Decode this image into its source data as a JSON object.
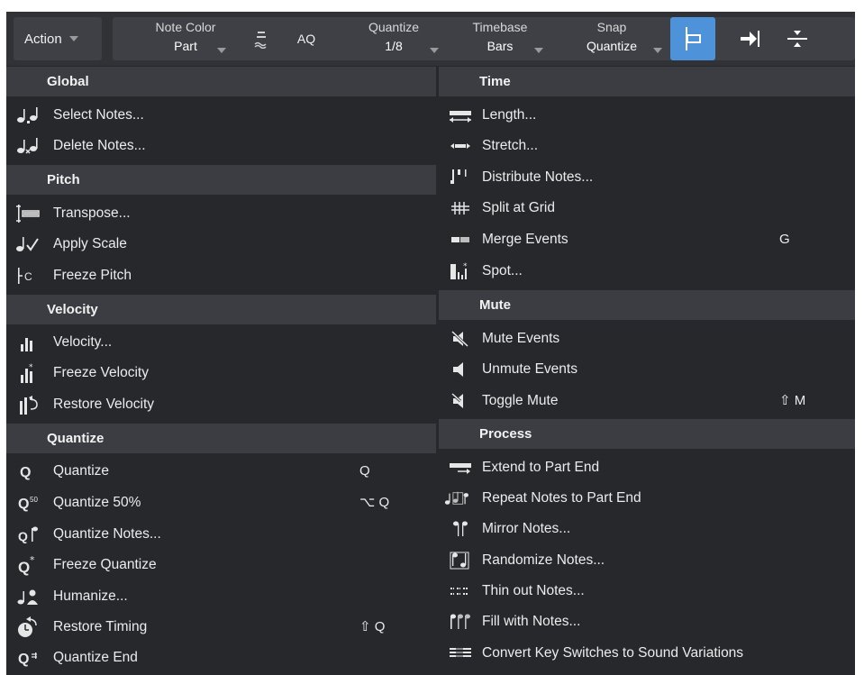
{
  "toolbar": {
    "action_label": "Action",
    "note_color": {
      "label": "Note Color",
      "value": "Part"
    },
    "aq_label": "AQ",
    "quantize": {
      "label": "Quantize",
      "value": "1/8"
    },
    "timebase": {
      "label": "Timebase",
      "value": "Bars"
    },
    "snap": {
      "label": "Snap",
      "value": "Quantize"
    }
  },
  "left": {
    "global": {
      "header": "Global",
      "items": [
        {
          "label": "Select Notes...",
          "icon": "select-notes-icon"
        },
        {
          "label": "Delete Notes...",
          "icon": "delete-notes-icon"
        }
      ]
    },
    "pitch": {
      "header": "Pitch",
      "items": [
        {
          "label": "Transpose...",
          "icon": "transpose-icon"
        },
        {
          "label": "Apply Scale",
          "icon": "apply-scale-icon"
        },
        {
          "label": "Freeze Pitch",
          "icon": "freeze-pitch-icon"
        }
      ]
    },
    "velocity": {
      "header": "Velocity",
      "items": [
        {
          "label": "Velocity...",
          "icon": "velocity-icon"
        },
        {
          "label": "Freeze Velocity",
          "icon": "freeze-velocity-icon"
        },
        {
          "label": "Restore Velocity",
          "icon": "restore-velocity-icon"
        }
      ]
    },
    "quantize": {
      "header": "Quantize",
      "items": [
        {
          "label": "Quantize",
          "icon": "quantize-icon",
          "shortcut": "Q"
        },
        {
          "label": "Quantize 50%",
          "icon": "quantize-50-icon",
          "shortcut": "⌥ Q"
        },
        {
          "label": "Quantize Notes...",
          "icon": "quantize-notes-icon"
        },
        {
          "label": "Freeze Quantize",
          "icon": "freeze-quantize-icon"
        },
        {
          "label": "Humanize...",
          "icon": "humanize-icon"
        },
        {
          "label": "Restore Timing",
          "icon": "restore-timing-icon",
          "shortcut": "⇧ Q"
        },
        {
          "label": "Quantize End",
          "icon": "quantize-end-icon"
        }
      ]
    }
  },
  "right": {
    "time": {
      "header": "Time",
      "items": [
        {
          "label": "Length...",
          "icon": "length-icon"
        },
        {
          "label": "Stretch...",
          "icon": "stretch-icon"
        },
        {
          "label": "Distribute Notes...",
          "icon": "distribute-notes-icon"
        },
        {
          "label": "Split at Grid",
          "icon": "split-at-grid-icon"
        },
        {
          "label": "Merge Events",
          "icon": "merge-events-icon",
          "shortcut": "G"
        },
        {
          "label": "Spot...",
          "icon": "spot-icon"
        }
      ]
    },
    "mute": {
      "header": "Mute",
      "items": [
        {
          "label": "Mute Events",
          "icon": "mute-events-icon"
        },
        {
          "label": "Unmute Events",
          "icon": "unmute-events-icon"
        },
        {
          "label": "Toggle Mute",
          "icon": "toggle-mute-icon",
          "shortcut": "⇧ M"
        }
      ]
    },
    "process": {
      "header": "Process",
      "items": [
        {
          "label": "Extend to Part End",
          "icon": "extend-to-part-end-icon"
        },
        {
          "label": "Repeat Notes to Part End",
          "icon": "repeat-notes-icon"
        },
        {
          "label": "Mirror Notes...",
          "icon": "mirror-notes-icon"
        },
        {
          "label": "Randomize Notes...",
          "icon": "randomize-notes-icon"
        },
        {
          "label": "Thin out Notes...",
          "icon": "thin-out-notes-icon"
        },
        {
          "label": "Fill with Notes...",
          "icon": "fill-with-notes-icon"
        },
        {
          "label": "Convert Key Switches to Sound Variations",
          "icon": "convert-key-switches-icon"
        }
      ]
    }
  },
  "colors": {
    "menu_bg": "#26282c",
    "header_bg": "#3b3d42",
    "toolbar_bg": "#303236",
    "accent": "#4e93d9"
  }
}
